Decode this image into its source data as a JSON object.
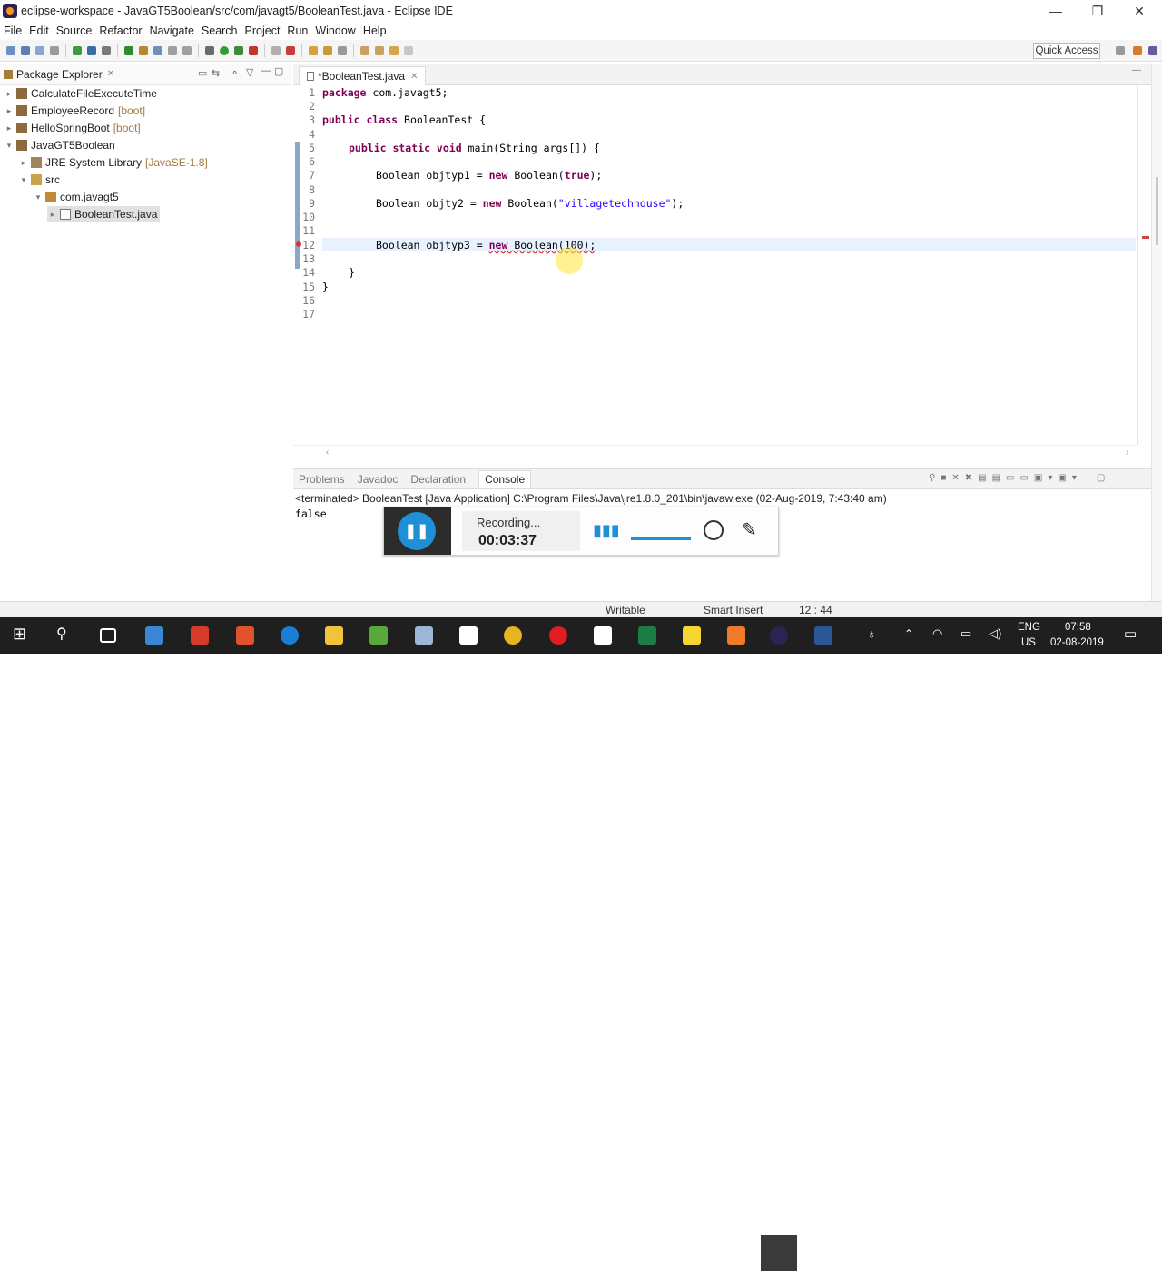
{
  "window": {
    "title": "eclipse-workspace - JavaGT5Boolean/src/com/javagt5/BooleanTest.java - Eclipse IDE"
  },
  "menu": [
    "File",
    "Edit",
    "Source",
    "Refactor",
    "Navigate",
    "Search",
    "Project",
    "Run",
    "Window",
    "Help"
  ],
  "toolbar": {
    "quick_access": "Quick Access"
  },
  "package_explorer": {
    "title": "Package Explorer",
    "items": [
      {
        "label": "CalculateFileExecuteTime",
        "decoration": ""
      },
      {
        "label": "EmployeeRecord",
        "decoration": "[boot]"
      },
      {
        "label": "HelloSpringBoot",
        "decoration": "[boot]"
      },
      {
        "label": "JavaGT5Boolean",
        "decoration": ""
      },
      {
        "label": "JRE System Library",
        "decoration": "[JavaSE-1.8]"
      },
      {
        "label": "src",
        "decoration": ""
      },
      {
        "label": "com.javagt5",
        "decoration": ""
      },
      {
        "label": "BooleanTest.java",
        "decoration": ""
      }
    ]
  },
  "editor": {
    "tab_label": "*BooleanTest.java",
    "line_numbers": [
      "1",
      "2",
      "3",
      "4",
      "5",
      "6",
      "7",
      "8",
      "9",
      "10",
      "11",
      "12",
      "13",
      "14",
      "15",
      "16",
      "17"
    ],
    "code": {
      "l1_kw": "package",
      "l1_rest": " com.javagt5;",
      "l3_kw": "public class",
      "l3_rest": " BooleanTest {",
      "l5_kw": "public static void",
      "l5_rest": " main(String args[]) {",
      "l7_a": "Boolean objtyp1 = ",
      "l7_kw": "new",
      "l7_b": " Boolean(",
      "l7_kw2": "true",
      "l7_c": ");",
      "l9_a": "Boolean objty2 = ",
      "l9_kw": "new",
      "l9_b": " Boolean(",
      "l9_str": "\"villagetechhouse\"",
      "l9_c": ");",
      "l12_a": "Boolean objtyp3 = ",
      "l12_kw": "new",
      "l12_b": " Boolean(100);",
      "l14": "}",
      "l15": "}"
    }
  },
  "console": {
    "tabs": [
      "Problems",
      "Javadoc",
      "Declaration",
      "Console"
    ],
    "active_tab": "Console",
    "header": "<terminated> BooleanTest [Java Application] C:\\Program Files\\Java\\jre1.8.0_201\\bin\\javaw.exe (02-Aug-2019, 7:43:40 am)",
    "output": "false"
  },
  "recorder": {
    "status": "Recording...",
    "time": "00:03:37"
  },
  "statusbar": {
    "mode": "Writable",
    "insert": "Smart Insert",
    "position": "12 : 44"
  },
  "taskbar": {
    "lang": "ENG",
    "region": "US",
    "time": "07:58",
    "date": "02-08-2019"
  }
}
